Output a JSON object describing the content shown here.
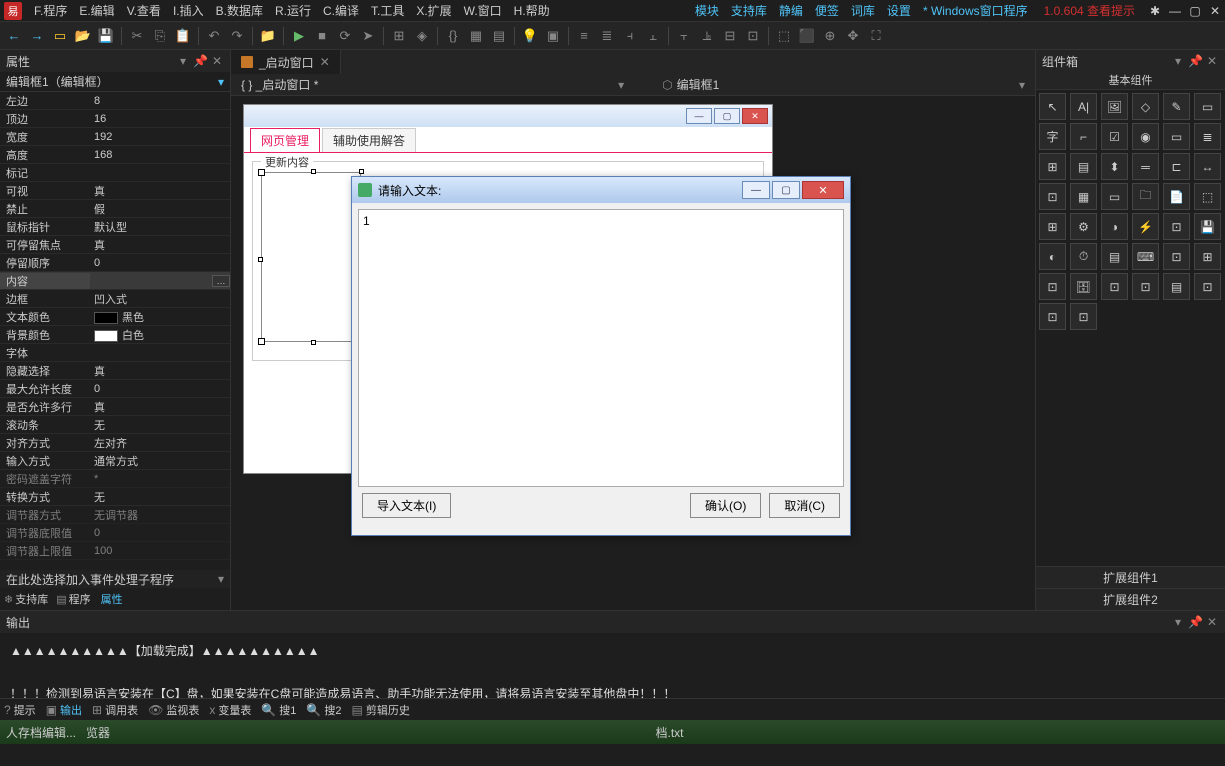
{
  "menu": {
    "items": [
      "F.程序",
      "E.编辑",
      "V.查看",
      "I.插入",
      "B.数据库",
      "R.运行",
      "C.编译",
      "T.工具",
      "X.扩展",
      "W.窗口",
      "H.帮助"
    ],
    "links": [
      "模块",
      "支持库",
      "静编",
      "便签",
      "词库",
      "设置"
    ],
    "doctitle": "* Windows窗口程序",
    "version": "1.0.604 查看提示"
  },
  "toolbar": {
    "icons": [
      {
        "g": "←",
        "c": "c-blue",
        "n": "nav-back-icon"
      },
      {
        "g": "→",
        "c": "c-blue",
        "n": "nav-fwd-icon"
      },
      {
        "g": "▭",
        "c": "c-yellow",
        "n": "new-icon"
      },
      {
        "g": "📂",
        "c": "c-yellow",
        "n": "open-icon"
      },
      {
        "g": "💾",
        "c": "c-blue",
        "n": "save-icon"
      },
      {
        "sep": true
      },
      {
        "g": "✂",
        "c": "c-gray",
        "n": "cut-icon"
      },
      {
        "g": "⎘",
        "c": "c-gray",
        "n": "copy-icon"
      },
      {
        "g": "📋",
        "c": "c-gray",
        "n": "paste-icon"
      },
      {
        "sep": true
      },
      {
        "g": "↶",
        "c": "c-gray",
        "n": "undo-icon"
      },
      {
        "g": "↷",
        "c": "c-gray",
        "n": "redo-icon"
      },
      {
        "sep": true
      },
      {
        "g": "📁",
        "c": "c-yellow",
        "n": "folder-icon"
      },
      {
        "sep": true
      },
      {
        "g": "▶",
        "c": "c-green",
        "n": "run-icon"
      },
      {
        "g": "■",
        "c": "c-gray",
        "n": "stop-icon"
      },
      {
        "g": "⟳",
        "c": "c-gray",
        "n": "restart-icon"
      },
      {
        "g": "➤",
        "c": "c-gray",
        "n": "step-icon"
      },
      {
        "sep": true
      },
      {
        "g": "⊞",
        "c": "c-gray",
        "n": "grid-icon"
      },
      {
        "g": "◈",
        "c": "c-gray",
        "n": "snap-icon"
      },
      {
        "sep": true
      },
      {
        "g": "{}",
        "c": "c-gray",
        "n": "code-icon"
      },
      {
        "g": "▦",
        "c": "c-gray",
        "n": "layout-icon"
      },
      {
        "g": "▤",
        "c": "c-gray",
        "n": "panel-icon"
      },
      {
        "sep": true
      },
      {
        "g": "💡",
        "c": "c-yellow",
        "n": "tip-icon"
      },
      {
        "g": "▣",
        "c": "c-gray",
        "n": "box-icon"
      },
      {
        "sep": true
      },
      {
        "g": "≡",
        "c": "c-gray",
        "n": "align-l-icon"
      },
      {
        "g": "≣",
        "c": "c-gray",
        "n": "align-c-icon"
      },
      {
        "g": "⫞",
        "c": "c-gray",
        "n": "align-r-icon"
      },
      {
        "g": "⫠",
        "c": "c-gray",
        "n": "align-t-icon"
      },
      {
        "sep": true
      },
      {
        "g": "⫟",
        "c": "c-gray",
        "n": "dist-h-icon"
      },
      {
        "g": "⫡",
        "c": "c-gray",
        "n": "dist-v-icon"
      },
      {
        "g": "⊟",
        "c": "c-gray",
        "n": "same-w-icon"
      },
      {
        "g": "⊡",
        "c": "c-gray",
        "n": "same-h-icon"
      },
      {
        "sep": true
      },
      {
        "g": "⬚",
        "c": "c-gray",
        "n": "front-icon"
      },
      {
        "g": "⬛",
        "c": "c-gray",
        "n": "back-icon"
      },
      {
        "g": "⊕",
        "c": "c-gray",
        "n": "center-icon"
      },
      {
        "g": "✥",
        "c": "c-gray",
        "n": "anchor-icon"
      },
      {
        "g": "⛶",
        "c": "c-gray",
        "n": "full-icon"
      }
    ]
  },
  "props": {
    "title": "属性",
    "object": "编辑框1（编辑框）",
    "rows": [
      {
        "n": "左边",
        "v": "8"
      },
      {
        "n": "顶边",
        "v": "16"
      },
      {
        "n": "宽度",
        "v": "192"
      },
      {
        "n": "高度",
        "v": "168"
      },
      {
        "n": "标记",
        "v": ""
      },
      {
        "n": "可视",
        "v": "真"
      },
      {
        "n": "禁止",
        "v": "假"
      },
      {
        "n": "鼠标指针",
        "v": "默认型"
      },
      {
        "n": "可停留焦点",
        "v": "真"
      },
      {
        "n": "  停留顺序",
        "v": "0"
      },
      {
        "n": "内容",
        "v": "",
        "sel": true,
        "dots": true
      },
      {
        "n": "边框",
        "v": "凹入式"
      },
      {
        "n": "文本颜色",
        "v": "黑色",
        "swatch": "#000"
      },
      {
        "n": "背景颜色",
        "v": "白色",
        "swatch": "#fff"
      },
      {
        "n": "字体",
        "v": ""
      },
      {
        "n": "隐藏选择",
        "v": "真"
      },
      {
        "n": "最大允许长度",
        "v": "0"
      },
      {
        "n": "是否允许多行",
        "v": "真"
      },
      {
        "n": "滚动条",
        "v": "无"
      },
      {
        "n": "对齐方式",
        "v": "左对齐"
      },
      {
        "n": "输入方式",
        "v": "通常方式"
      },
      {
        "n": "密码遮盖字符",
        "v": "*",
        "dim": true
      },
      {
        "n": "转换方式",
        "v": "无"
      },
      {
        "n": "调节器方式",
        "v": "无调节器",
        "dim": true
      },
      {
        "n": "调节器底限值",
        "v": "0",
        "dim": true
      },
      {
        "n": "调节器上限值",
        "v": "100",
        "dim": true
      }
    ],
    "eventline": "在此处选择加入事件处理子程序",
    "tabs": [
      {
        "l": "支持库",
        "i": "❄"
      },
      {
        "l": "程序",
        "i": "▤"
      },
      {
        "l": "属性",
        "i": "",
        "active": true
      }
    ]
  },
  "editor": {
    "tab": "_启动窗口",
    "crumbA": "{ } _启动窗口 *",
    "crumbB": "编辑框1",
    "dtabs": [
      "网页管理",
      "辅助使用解答"
    ],
    "grouptitle": "更新内容"
  },
  "dialog": {
    "title": "请输入文本:",
    "value": "1",
    "btns": {
      "import": "导入文本(I)",
      "ok": "确认(O)",
      "cancel": "取消(C)"
    }
  },
  "compbox": {
    "title": "组件箱",
    "tab": "基本组件",
    "items": [
      "↖",
      "A|",
      "🖼",
      "◇",
      "✎",
      "▭",
      "字",
      "⌐",
      "☑",
      "◉",
      "▭",
      "≣",
      "⊞",
      "▤",
      "⬍",
      "═",
      "⊏",
      "↔",
      "⊡",
      "▦",
      "▭",
      "🗀",
      "📄",
      "⬚",
      "⊞",
      "⚙",
      "◑",
      "⚡",
      "⊡",
      "💾",
      "◐",
      "⏱",
      "▤",
      "⌨",
      "⊡",
      "⊞",
      "⊡",
      "🗄",
      "⊡",
      "⊡",
      "▤",
      "⊡",
      "⊡",
      "⊡"
    ],
    "ext": [
      "扩展组件1",
      "扩展组件2"
    ]
  },
  "output": {
    "title": "输出",
    "line1": "▲▲▲▲▲▲▲▲▲▲【加载完成】▲▲▲▲▲▲▲▲▲▲",
    "line2": "！！！检测到易语言安装在【C】盘，如果安装在C盘可能造成易语言、助手功能无法使用，请将易语言安装至其他盘中！！！",
    "tabs": [
      {
        "i": "?",
        "l": "提示"
      },
      {
        "i": "▣",
        "l": "输出",
        "active": true
      },
      {
        "i": "⊞",
        "l": "调用表"
      },
      {
        "i": "👁",
        "l": "监视表"
      },
      {
        "i": "x",
        "l": "变量表"
      },
      {
        "i": "🔍",
        "l": "搜1"
      },
      {
        "i": "🔍",
        "l": "搜2"
      },
      {
        "i": "▤",
        "l": "剪辑历史"
      }
    ]
  },
  "taskbar": {
    "items": [
      "人存档编辑...",
      "览器"
    ],
    "center": "档.txt"
  }
}
